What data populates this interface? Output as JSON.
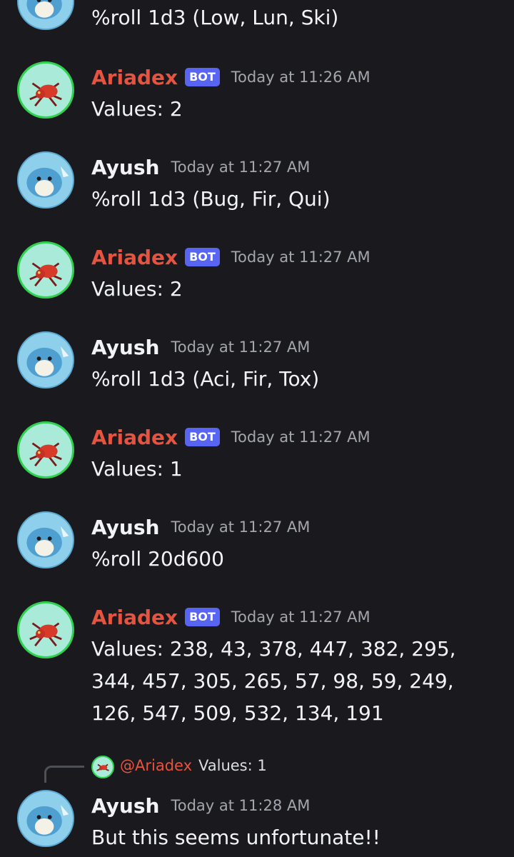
{
  "colors": {
    "background": "#1a1a1e",
    "bot_name": "#e6533f",
    "bot_badge": "#5865f2",
    "timestamp": "#a3a6ad",
    "text": "#f2f3f5"
  },
  "messages": [
    {
      "author": "",
      "bot": false,
      "badge": "",
      "time": "",
      "content": "%roll 1d3 (Low, Lun, Ski)",
      "avatar_icon": "spheal-avatar"
    },
    {
      "author": "Ariadex",
      "bot": true,
      "badge": "BOT",
      "time": "Today at 11:26 AM",
      "content": "Values: 2",
      "avatar_icon": "ariados-avatar"
    },
    {
      "author": "Ayush",
      "bot": false,
      "badge": "",
      "time": "Today at 11:27 AM",
      "content": "%roll 1d3 (Bug, Fir, Qui)",
      "avatar_icon": "spheal-avatar"
    },
    {
      "author": "Ariadex",
      "bot": true,
      "badge": "BOT",
      "time": "Today at 11:27 AM",
      "content": "Values: 2",
      "avatar_icon": "ariados-avatar"
    },
    {
      "author": "Ayush",
      "bot": false,
      "badge": "",
      "time": "Today at 11:27 AM",
      "content": "%roll 1d3 (Aci, Fir, Tox)",
      "avatar_icon": "spheal-avatar"
    },
    {
      "author": "Ariadex",
      "bot": true,
      "badge": "BOT",
      "time": "Today at 11:27 AM",
      "content": "Values: 1",
      "avatar_icon": "ariados-avatar"
    },
    {
      "author": "Ayush",
      "bot": false,
      "badge": "",
      "time": "Today at 11:27 AM",
      "content": "%roll 20d600",
      "avatar_icon": "spheal-avatar"
    },
    {
      "author": "Ariadex",
      "bot": true,
      "badge": "BOT",
      "time": "Today at 11:27 AM",
      "content": "Values: 238, 43, 378, 447, 382, 295, 344, 457, 305, 265, 57, 98, 59, 249, 126, 547, 509, 532, 134, 191",
      "avatar_icon": "ariados-avatar"
    },
    {
      "author": "Ayush",
      "bot": false,
      "badge": "",
      "time": "Today at 11:28 AM",
      "content": "But this seems unfortunate!!",
      "avatar_icon": "spheal-avatar"
    }
  ],
  "reply": {
    "mention": "@Ariadex",
    "text": "Values: 1",
    "avatar_icon": "ariados-avatar"
  }
}
